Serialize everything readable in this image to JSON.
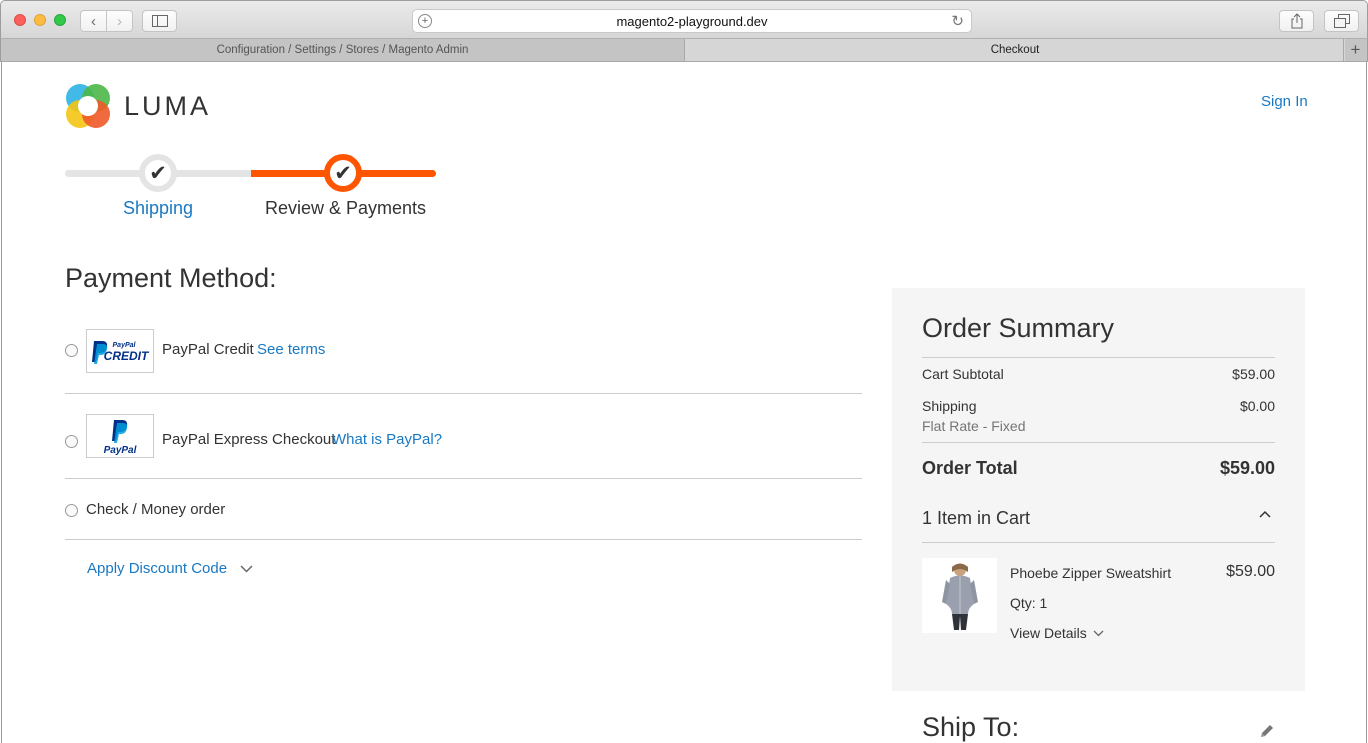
{
  "browser": {
    "url": "magento2-playground.dev",
    "tabs": [
      {
        "label": "Configuration / Settings / Stores / Magento Admin"
      },
      {
        "label": "Checkout"
      }
    ],
    "new_tab": "+"
  },
  "header": {
    "brand": "LUMA",
    "sign_in": "Sign In"
  },
  "progress": {
    "steps": [
      {
        "label": "Shipping"
      },
      {
        "label": "Review & Payments"
      }
    ],
    "check": "✔"
  },
  "payment": {
    "title": "Payment Method:",
    "methods": [
      {
        "label": "PayPal Credit",
        "link": "See terms",
        "logo_top": "PayPal",
        "logo_bottom": "CREDIT"
      },
      {
        "label": "PayPal Express Checkout",
        "link": "What is PayPal?",
        "logo_text": "PayPal"
      },
      {
        "label": "Check / Money order"
      }
    ],
    "discount_label": "Apply Discount Code"
  },
  "summary": {
    "title": "Order Summary",
    "subtotal_label": "Cart Subtotal",
    "subtotal_value": "$59.00",
    "shipping_label": "Shipping",
    "shipping_value": "$0.00",
    "shipping_method": "Flat Rate - Fixed",
    "total_label": "Order Total",
    "total_value": "$59.00",
    "items_header": "1 Item in Cart",
    "item": {
      "name": "Phoebe Zipper Sweatshirt",
      "price": "$59.00",
      "qty": "Qty: 1",
      "details": "View Details"
    }
  },
  "ship_to": {
    "title": "Ship To:"
  },
  "colors": {
    "link": "#1979c3",
    "accent": "#ff5501",
    "summary_bg": "#f5f5f5"
  }
}
